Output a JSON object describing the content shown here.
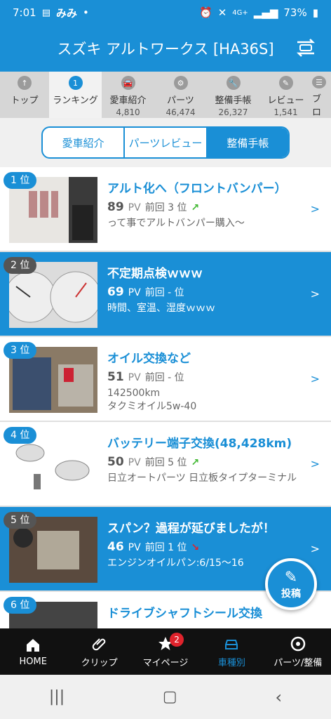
{
  "status_bar": {
    "time": "7:01",
    "app_icons": "みみ",
    "dot": "•",
    "network": "4G+",
    "battery": "73%"
  },
  "app_bar": {
    "title": "スズキ アルトワークス [HA36S]"
  },
  "tabs": [
    {
      "label": "トップ",
      "count": ""
    },
    {
      "label": "ランキング",
      "count": "",
      "icon_text": "1"
    },
    {
      "label": "愛車紹介",
      "count": "4,810"
    },
    {
      "label": "パーツ",
      "count": "46,474"
    },
    {
      "label": "整備手帳",
      "count": "26,327"
    },
    {
      "label": "レビュー",
      "count": "1,541"
    },
    {
      "label": "ブロ",
      "count": ""
    }
  ],
  "segments": [
    "愛車紹介",
    "パーツレビュー",
    "整備手帳"
  ],
  "pv_unit": "PV",
  "items": [
    {
      "rank": "1 位",
      "title": "アルト化へ（フロントバンパー）",
      "pv": "89",
      "prev": "前回 3 位",
      "trend": "up",
      "desc": "って事でアルトバンパー購入〜"
    },
    {
      "rank": "2 位",
      "title": "不定期点検ｗｗｗ",
      "pv": "69",
      "prev": "前回 - 位",
      "trend": "",
      "desc": "時間、室温、湿度ｗｗｗ"
    },
    {
      "rank": "3 位",
      "title": "オイル交換など",
      "pv": "51",
      "prev": "前回 - 位",
      "trend": "",
      "desc": "142500km\nタクミオイル5w-40"
    },
    {
      "rank": "4 位",
      "title": "バッテリー端子交換(48,428km)",
      "pv": "50",
      "prev": "前回 5 位",
      "trend": "up",
      "desc": "日立オートパーツ 日立板タイプターミナル"
    },
    {
      "rank": "5 位",
      "title": "スパン？過程が延びましたが！",
      "pv": "46",
      "prev": "前回 1 位",
      "trend": "down",
      "desc": "エンジンオイルパン:6/15〜16"
    },
    {
      "rank": "6 位",
      "title": "ドライブシャフトシール交換",
      "pv": "",
      "prev": "",
      "trend": "",
      "desc": ""
    }
  ],
  "fab": {
    "label": "投稿"
  },
  "bottom_nav": [
    {
      "label": "HOME"
    },
    {
      "label": "クリップ"
    },
    {
      "label": "マイページ",
      "badge": "2"
    },
    {
      "label": "車種別"
    },
    {
      "label": "パーツ/整備"
    }
  ],
  "colors": {
    "accent": "#1a8fd6",
    "up": "#41b832",
    "down": "#e0232c"
  }
}
